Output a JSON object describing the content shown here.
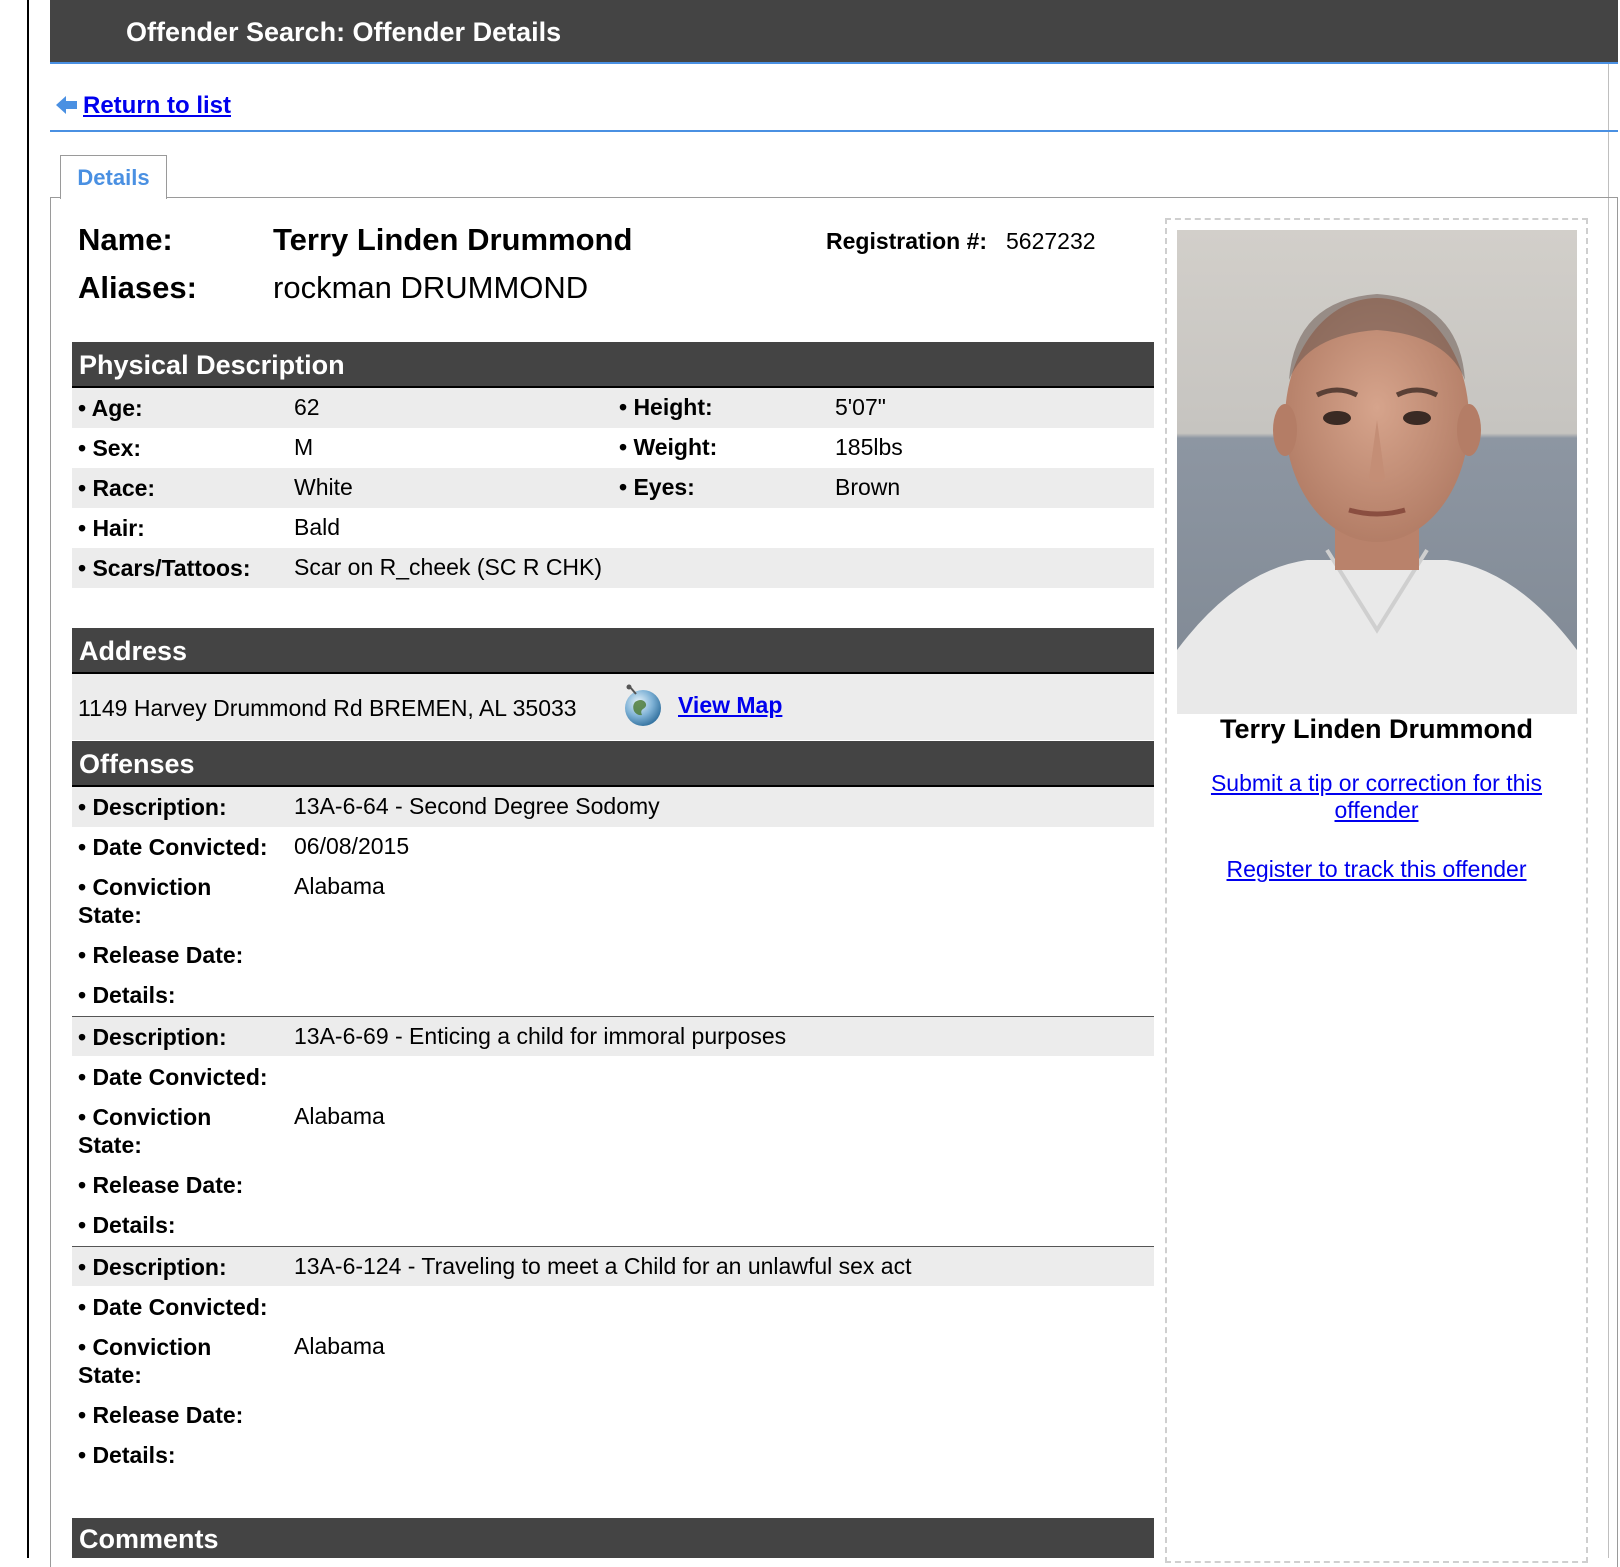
{
  "page": {
    "title": "Offender Search: Offender Details",
    "return_link": "Return to list",
    "tab_details": "Details"
  },
  "header": {
    "name_label": "Name:",
    "name_value": "Terry Linden Drummond",
    "aliases_label": "Aliases:",
    "aliases_value": "rockman DRUMMOND",
    "registration_label": "Registration #:",
    "registration_value": "5627232"
  },
  "physical": {
    "section_title": "Physical Description",
    "age_label": "• Age:",
    "age": "62",
    "height_label": "• Height:",
    "height": "5'07\"",
    "sex_label": "• Sex:",
    "sex": "M",
    "weight_label": "• Weight:",
    "weight": "185lbs",
    "race_label": "• Race:",
    "race": "White",
    "eyes_label": "• Eyes:",
    "eyes": "Brown",
    "hair_label": "• Hair:",
    "hair": "Bald",
    "scars_label": "• Scars/Tattoos:",
    "scars": "Scar on R_cheek (SC R CHK)"
  },
  "address": {
    "section_title": "Address",
    "value": "1149 Harvey Drummond Rd BREMEN, AL 35033",
    "map_link": "View Map"
  },
  "offenses": {
    "section_title": "Offenses",
    "labels": {
      "description": "• Description:",
      "date_convicted": "• Date Convicted:",
      "conviction_state_1": "• Conviction",
      "conviction_state_2": "State:",
      "release_date": "• Release Date:",
      "details": "• Details:"
    },
    "items": [
      {
        "description": "13A-6-64 - Second Degree Sodomy",
        "date_convicted": "06/08/2015",
        "conviction_state": "Alabama",
        "release_date": "",
        "details": ""
      },
      {
        "description": "13A-6-69 - Enticing a child for immoral purposes",
        "date_convicted": "",
        "conviction_state": "Alabama",
        "release_date": "",
        "details": ""
      },
      {
        "description": "13A-6-124 - Traveling to meet a Child for an unlawful sex act",
        "date_convicted": "",
        "conviction_state": "Alabama",
        "release_date": "",
        "details": ""
      }
    ]
  },
  "comments": {
    "section_title": "Comments"
  },
  "sidebar": {
    "photo_name": "Terry Linden Drummond",
    "tip_link_line1": "Submit a tip or correction for this",
    "tip_link_line2": "offender",
    "track_link": "Register to track this offender"
  },
  "colors": {
    "header_bar": "#444444",
    "accent_blue": "#4a90e2",
    "link": "#0000ee",
    "row_shade": "#ececec"
  },
  "icons": {
    "return": "left-arrow-icon",
    "map": "globe-icon"
  }
}
